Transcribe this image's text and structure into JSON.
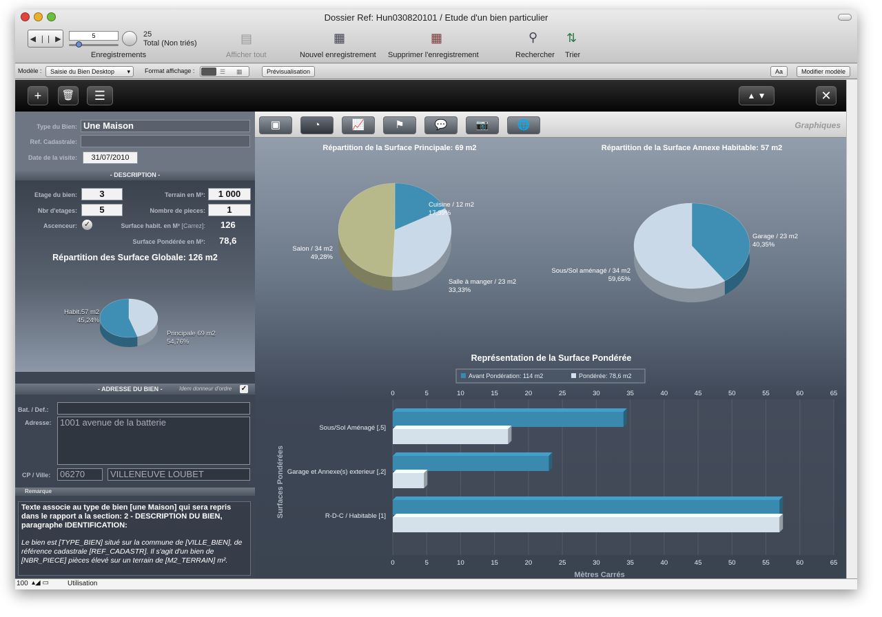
{
  "window": {
    "title": "Dossier Ref: Hun030820101 / Etude d'un bien particulier"
  },
  "toolbar": {
    "record_value": "5",
    "record_count": "25",
    "record_total": "Total (Non triés)",
    "records_label": "Enregistrements",
    "show_all": "Afficher tout",
    "new_record": "Nouvel enregistrement",
    "delete_record": "Supprimer l'enregistrement",
    "search": "Rechercher",
    "sort": "Trier"
  },
  "modebar": {
    "model_label": "Modèle :",
    "model_value": "Saisie du Bien Desktop",
    "format_label": "Format affichage :",
    "preview": "Prévisualisation",
    "aa": "Aa",
    "modify": "Modifier modèle"
  },
  "form": {
    "type_label": "Type du Bien:",
    "type_value": "Une Maison",
    "cadastre_label": "Ref. Cadastrale:",
    "cadastre_value": "",
    "date_label": "Date de la visite:",
    "date_value": "31/07/2010",
    "description_header": "- DESCRIPTION -",
    "etage_label": "Etage du bien:",
    "etage_value": "3",
    "terrain_label": "Terrain en M²:",
    "terrain_value": "1 000",
    "nbr_etages_label": "Nbr d'etages:",
    "nbr_etages_value": "5",
    "pieces_label": "Nombre de pieces:",
    "pieces_value": "1",
    "ascenseur_label": "Ascenceur:",
    "surface_habit_label": "Surface habit. en M²",
    "surface_habit_note": "[Carrez]:",
    "surface_habit_value": "126",
    "surface_ponderee_label": "Surface Pondérée en M²:",
    "surface_ponderee_value": "78,6",
    "globale_title": "Répartition des Surface Globale: 126 m2",
    "globale_habit": "Habit.57 m2",
    "globale_habit_pct": "45,24%",
    "globale_principale": "Principale 69 m2",
    "globale_principale_pct": "54,76%",
    "adresse_header": "- ADRESSE DU BIEN -",
    "idem_label": "Idem donneur d'ordre",
    "bat_label": "Bat. / Def.:",
    "bat_value": "",
    "adresse_label": "Adresse:",
    "adresse_value": "1001 avenue de la batterie",
    "cp_label": "CP / Ville:",
    "cp_value": "06270",
    "ville_value": "VILLENEUVE LOUBET",
    "remarque_label": "Remarque",
    "remarque_bold": "Texte associe au type de bien [une Maison] qui sera repris dans le rapport a la section: 2 - DESCRIPTION DU BIEN, paragraphe IDENTIFICATION:",
    "remarque_italic": "Le bien est [TYPE_BIEN] situé sur la commune de [VILLE_BIEN], de référence cadastrale [REF_CADASTR]. Il s'agit d'un bien de [NBR_PIECE] pièces élevé sur un terrain de [M2_TERRAIN] m²."
  },
  "graph": {
    "section_title": "Graphiques"
  },
  "status": {
    "zoom": "100",
    "mode": "Utilisation"
  },
  "chart_data": [
    {
      "type": "pie",
      "title": "Répartition des Surface Globale: 126 m2",
      "categories": [
        "Habit.57 m2",
        "Principale 69 m2"
      ],
      "values": [
        57,
        69
      ],
      "percent_labels": [
        "45,24%",
        "54,76%"
      ],
      "colors": [
        "#c9d9e8",
        "#3f8eb3"
      ]
    },
    {
      "type": "pie",
      "title": "Répartition de la Surface Principale: 69 m2",
      "categories": [
        "Cuisine / 12 m2",
        "Salle à manger / 23 m2",
        "Salon / 34 m2"
      ],
      "values": [
        12,
        23,
        34
      ],
      "percent_labels": [
        "17,39%",
        "33,33%",
        "49,28%"
      ],
      "colors": [
        "#3f8eb3",
        "#c9d9e8",
        "#b8b98a"
      ]
    },
    {
      "type": "pie",
      "title": "Répartition de la Surface Annexe Habitable: 57 m2",
      "categories": [
        "Garage / 23 m2",
        "Sous/Sol aménagé / 34 m2"
      ],
      "values": [
        23,
        34
      ],
      "percent_labels": [
        "40,35%",
        "59,65%"
      ],
      "colors": [
        "#3f8eb3",
        "#c9d9e8"
      ]
    },
    {
      "type": "bar",
      "orientation": "horizontal",
      "title": "Représentation de la Surface Pondérée",
      "categories": [
        "Sous/Sol Aménagé [,5]",
        "Garage et Annexe(s) exterieur [,2]",
        "R-D-C / Habitable [1]"
      ],
      "series": [
        {
          "name": "Avant Pondération: 114 m2",
          "values": [
            34,
            23,
            57
          ],
          "color": "#3a8ab0"
        },
        {
          "name": "Pondérée: 78,6 m2",
          "values": [
            17,
            4.6,
            57
          ],
          "color": "#d4e0ea"
        }
      ],
      "xlabel": "Mètres Carrés",
      "ylabel": "Surfaces Pondérées",
      "xlim": [
        0,
        65
      ],
      "ticks": [
        0,
        5,
        10,
        15,
        20,
        25,
        30,
        35,
        40,
        45,
        50,
        55,
        60,
        65
      ],
      "legend": "top"
    }
  ]
}
